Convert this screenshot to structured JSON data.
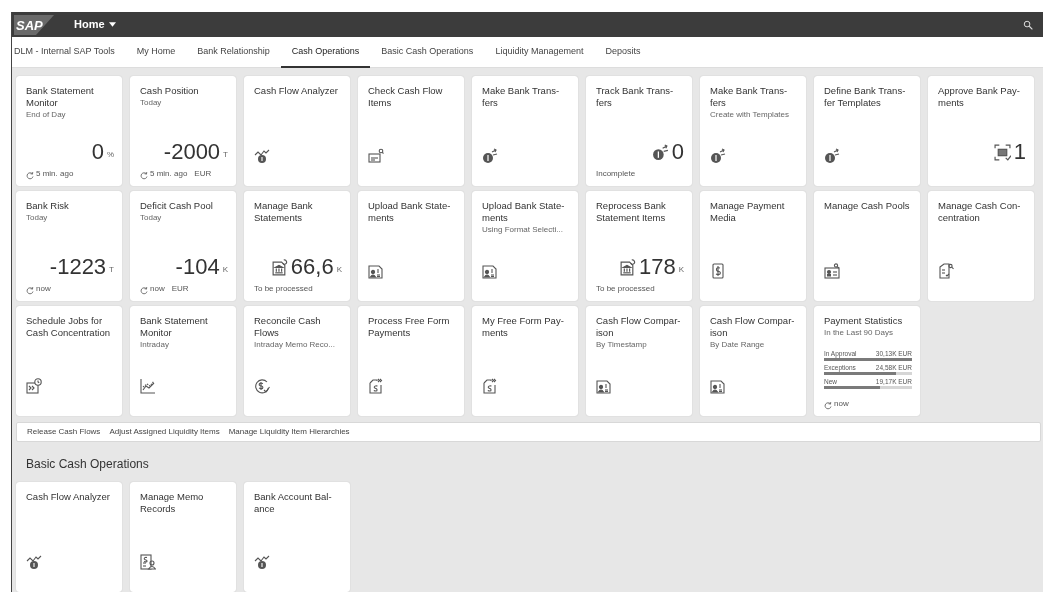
{
  "shell": {
    "logo": "SAP",
    "menu": "Home"
  },
  "tabs": [
    {
      "label": "DLM - Internal SAP Tools",
      "selected": false
    },
    {
      "label": "My Home",
      "selected": false
    },
    {
      "label": "Bank Relationship",
      "selected": false
    },
    {
      "label": "Cash Operations",
      "selected": true
    },
    {
      "label": "Basic Cash Operations",
      "selected": false
    },
    {
      "label": "Liquidity Management",
      "selected": false
    },
    {
      "label": "Deposits",
      "selected": false
    }
  ],
  "groups": [
    {
      "tiles": [
        {
          "kind": "kpi",
          "title": "Bank Statement\nMonitor",
          "subtitle": "End of Day",
          "value": "0",
          "unit": "%",
          "footer": {
            "refresh": true,
            "text": "5 min. ago"
          }
        },
        {
          "kind": "kpi",
          "title": "Cash Position",
          "subtitle": "Today",
          "value": "-2000",
          "unit": "T",
          "footer": {
            "refresh": true,
            "text": "5 min. ago",
            "currency": "EUR"
          }
        },
        {
          "kind": "launch",
          "title": "Cash Flow Analyzer"
        },
        {
          "kind": "launch",
          "title": "Check Cash Flow\nItems"
        },
        {
          "kind": "launch",
          "title": "Make Bank Trans-\nfers"
        },
        {
          "kind": "kpi",
          "title": "Track Bank Trans-\nfers",
          "value": "0",
          "footer": {
            "refresh": false,
            "text": "Incomplete"
          }
        },
        {
          "kind": "launch",
          "title": "Make Bank Trans-\nfers",
          "subtitle": "Create with Templates"
        },
        {
          "kind": "launch",
          "title": "Define Bank Trans-\nfer Templates"
        },
        {
          "kind": "kpi",
          "title": "Approve Bank Pay-\nments",
          "value": "1"
        },
        {
          "kind": "kpi",
          "title": "Bank Risk",
          "subtitle": "Today",
          "value": "-1223",
          "unit": "T",
          "footer": {
            "refresh": true,
            "text": "now"
          }
        },
        {
          "kind": "kpi",
          "title": "Deficit Cash Pool",
          "subtitle": "Today",
          "value": "-104",
          "unit": "K",
          "footer": {
            "refresh": true,
            "text": "now",
            "currency": "EUR"
          }
        },
        {
          "kind": "kpi",
          "title": "Manage Bank\nStatements",
          "value": "66,6",
          "unit": "K",
          "footer": {
            "refresh": false,
            "text": "To be processed"
          }
        },
        {
          "kind": "launch",
          "title": "Upload Bank State-\nments"
        },
        {
          "kind": "launch",
          "title": "Upload Bank State-\nments",
          "subtitle": "Using Format Selecti..."
        },
        {
          "kind": "kpi",
          "title": "Reprocess Bank\nStatement Items",
          "value": "178",
          "unit": "K",
          "footer": {
            "refresh": false,
            "text": "To be processed"
          }
        },
        {
          "kind": "launch",
          "title": "Manage Payment\nMedia"
        },
        {
          "kind": "launch",
          "title": "Manage Cash Pools"
        },
        {
          "kind": "launch",
          "title": "Manage Cash Con-\ncentration"
        },
        {
          "kind": "launch",
          "title": "Schedule Jobs for\nCash Concentration"
        },
        {
          "kind": "launch",
          "title": "Bank Statement\nMonitor",
          "subtitle": "Intraday"
        },
        {
          "kind": "launch",
          "title": "Reconcile Cash\nFlows",
          "subtitle": "Intraday Memo Reco..."
        },
        {
          "kind": "launch",
          "title": "Process Free Form\nPayments"
        },
        {
          "kind": "launch",
          "title": "My Free Form Pay-\nments"
        },
        {
          "kind": "launch",
          "title": "Cash Flow Compar-\nison",
          "subtitle": "By Timestamp"
        },
        {
          "kind": "launch",
          "title": "Cash Flow Compar-\nison",
          "subtitle": "By Date Range"
        },
        {
          "kind": "stats",
          "title": "Payment Statistics",
          "subtitle": "In the Last 90 Days",
          "rows": [
            {
              "label": "In Approval",
              "value": "30,13K EUR",
              "level": 1.0
            },
            {
              "label": "Exceptions",
              "value": "24,58K EUR",
              "level": 0.82
            },
            {
              "label": "New",
              "value": "19,17K EUR",
              "level": 0.64
            }
          ],
          "footer": {
            "refresh": true,
            "text": "now"
          }
        }
      ],
      "links": [
        "Release Cash Flows",
        "Adjust Assigned Liquidity Items",
        "Manage Liquidity Item Hierarchies"
      ]
    },
    {
      "title": "Basic Cash Operations",
      "tiles": [
        {
          "kind": "launch",
          "title": "Cash Flow Analyzer"
        },
        {
          "kind": "launch",
          "title": "Manage Memo\nRecords"
        },
        {
          "kind": "launch",
          "title": "Bank Account Bal-\nance"
        }
      ]
    }
  ]
}
